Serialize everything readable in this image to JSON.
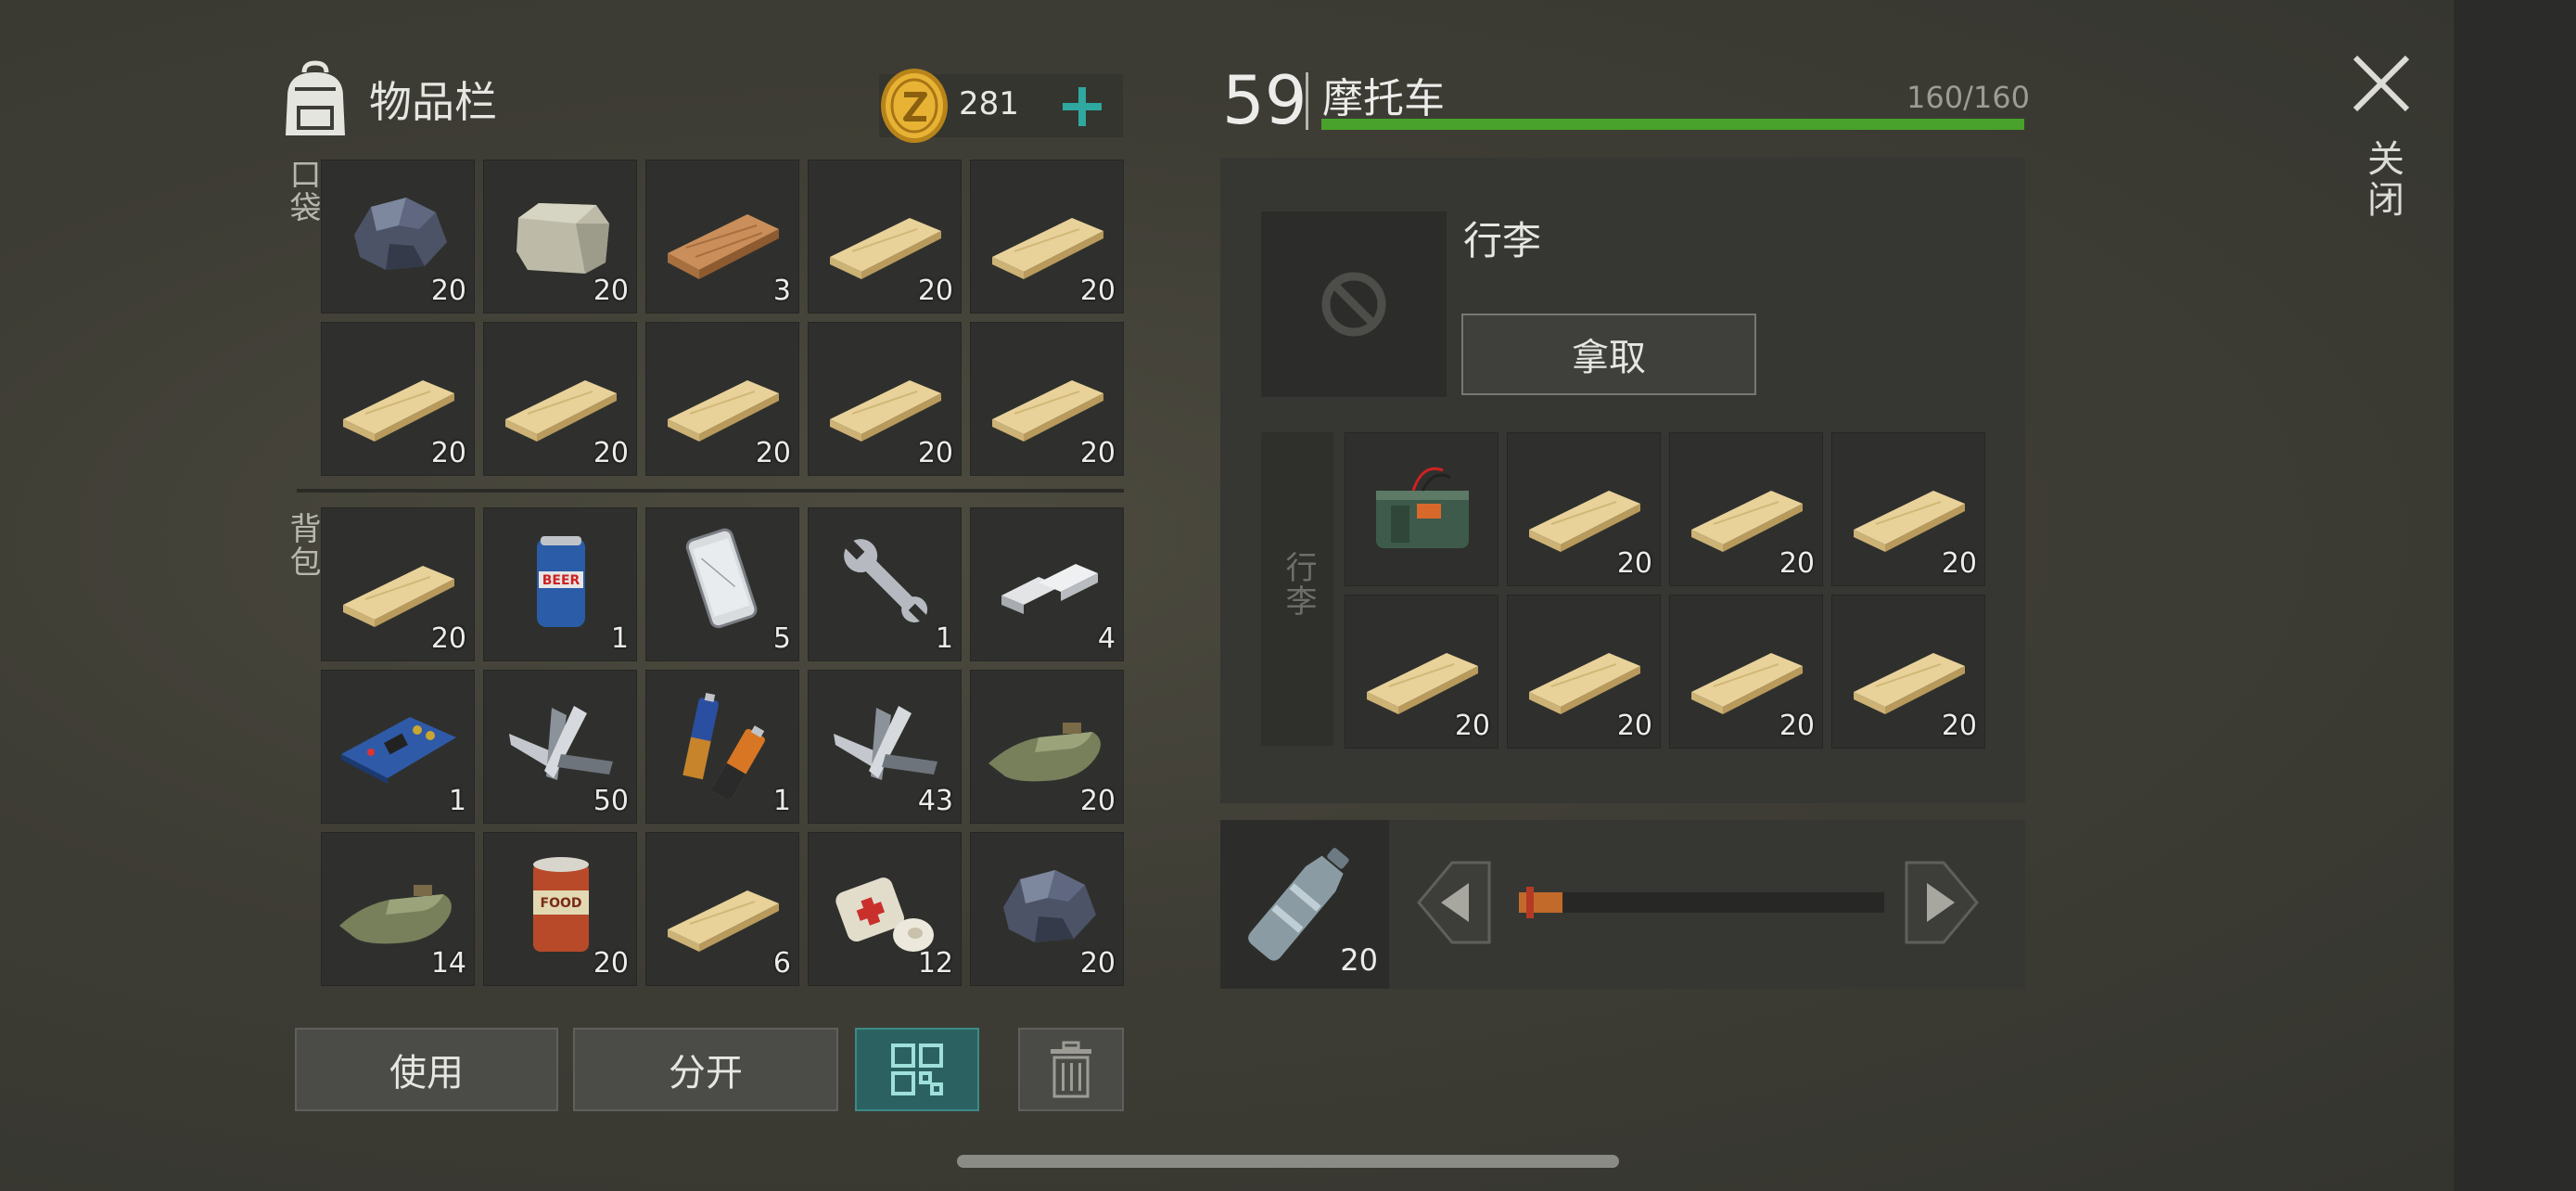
{
  "inventory": {
    "title": "物品栏",
    "coins": "281",
    "pocket_label": "口袋",
    "backpack_label": "背包",
    "pocket_items": [
      {
        "icon": "iron-ore-icon",
        "qty": "20"
      },
      {
        "icon": "stone-icon",
        "qty": "20"
      },
      {
        "icon": "wood-plank-icon",
        "qty": "3"
      },
      {
        "icon": "pine-plank-icon",
        "qty": "20"
      },
      {
        "icon": "pine-plank-icon",
        "qty": "20"
      },
      {
        "icon": "pine-plank-icon",
        "qty": "20"
      },
      {
        "icon": "pine-plank-icon",
        "qty": "20"
      },
      {
        "icon": "pine-plank-icon",
        "qty": "20"
      },
      {
        "icon": "pine-plank-icon",
        "qty": "20"
      },
      {
        "icon": "pine-plank-icon",
        "qty": "20"
      }
    ],
    "backpack_items": [
      {
        "icon": "pine-plank-icon",
        "qty": "20"
      },
      {
        "icon": "beer-can-icon",
        "qty": "1"
      },
      {
        "icon": "smartphone-icon",
        "qty": "5"
      },
      {
        "icon": "wrench-icon",
        "qty": "1"
      },
      {
        "icon": "metal-bars-icon",
        "qty": "4"
      },
      {
        "icon": "circuit-board-icon",
        "qty": "1"
      },
      {
        "icon": "scrap-metal-icon",
        "qty": "50"
      },
      {
        "icon": "batteries-icon",
        "qty": "1"
      },
      {
        "icon": "scrap-metal-icon",
        "qty": "43"
      },
      {
        "icon": "cloth-icon",
        "qty": "20"
      },
      {
        "icon": "cloth-icon",
        "qty": "14"
      },
      {
        "icon": "food-can-icon",
        "qty": "20"
      },
      {
        "icon": "pine-plank-icon",
        "qty": "6"
      },
      {
        "icon": "bandage-icon",
        "qty": "12"
      },
      {
        "icon": "iron-ore-icon",
        "qty": "20"
      }
    ],
    "buttons": {
      "use": "使用",
      "split": "分开"
    }
  },
  "vehicle": {
    "level": "59",
    "name": "摩托车",
    "capacity_text": "160/160",
    "capacity_fraction": 1.0,
    "luggage_title": "行李",
    "take_button": "拿取",
    "luggage_side_label": "行李",
    "luggage_items": [
      {
        "icon": "explosive-charge-icon",
        "qty": ""
      },
      {
        "icon": "pine-plank-icon",
        "qty": "20"
      },
      {
        "icon": "pine-plank-icon",
        "qty": "20"
      },
      {
        "icon": "pine-plank-icon",
        "qty": "20"
      },
      {
        "icon": "pine-plank-icon",
        "qty": "20"
      },
      {
        "icon": "pine-plank-icon",
        "qty": "20"
      },
      {
        "icon": "pine-plank-icon",
        "qty": "20"
      },
      {
        "icon": "pine-plank-icon",
        "qty": "20"
      }
    ],
    "fuel": {
      "item_icon": "water-bottle-icon",
      "qty": "20",
      "level_fraction": 0.12
    }
  },
  "close_label": "关闭",
  "colors": {
    "accent": "#2b6261",
    "capacity_bar": "#49a22b",
    "slider": "#c26a2a",
    "coin": "#e0a92a"
  }
}
